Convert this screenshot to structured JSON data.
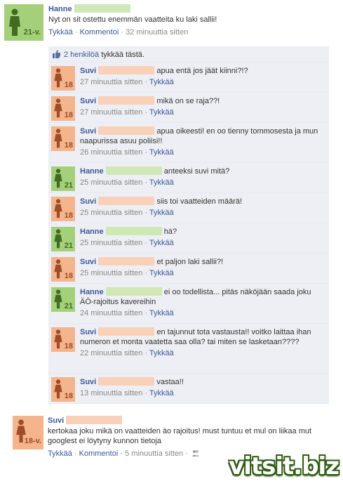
{
  "post": {
    "author": "Hanne",
    "avatar_age": "21-v.",
    "message": "Nyt on sit ostettu enemmän vaatteita ku laki sallii!",
    "like_link": "Tykkää",
    "comment_link": "Kommentoi",
    "time": "32 minuuttia sitten",
    "likes_count": "2 henkilöä",
    "likes_suffix": "tykkää tästä."
  },
  "comments": [
    {
      "author": "Suvi",
      "age": "18",
      "color": "peach",
      "text": "apua entä jos jäät kiinni?!?",
      "time": "27 minuuttia sitten",
      "like": "Tykkää"
    },
    {
      "author": "Suvi",
      "age": "18",
      "color": "peach",
      "text": "mikä on se raja??!",
      "time": "27 minuuttia sitten",
      "like": "Tykkää"
    },
    {
      "author": "Suvi",
      "age": "18",
      "color": "peach",
      "text": "apua oikeesti! en oo tienny tommosesta ja mun naapurissa asuu poliisi!!",
      "time": "26 minuuttia sitten",
      "like": "Tykkää"
    },
    {
      "author": "Hanne",
      "age": "21",
      "color": "green",
      "text": "anteeksi suvi mitä?",
      "time": "25 minuuttia sitten",
      "like": "Tykkää"
    },
    {
      "author": "Suvi",
      "age": "18",
      "color": "peach",
      "text": "siis toi vaatteiden määrä!",
      "time": "25 minuuttia sitten",
      "like": "Tykkää"
    },
    {
      "author": "Hanne",
      "age": "21",
      "color": "green",
      "text": "hä?",
      "time": "25 minuuttia sitten",
      "like": "Tykkää"
    },
    {
      "author": "Suvi",
      "age": "18",
      "color": "peach",
      "text": "et paljon laki sallii?!",
      "time": "25 minuuttia sitten",
      "like": "Tykkää"
    },
    {
      "author": "Hanne",
      "age": "21",
      "color": "green",
      "text": "ei oo todellista... pitäs näköjään saada joku ÄÖ-rajoitus kavereihin",
      "time": "24 minuuttia sitten",
      "like": "Tykkää"
    },
    {
      "author": "Suvi",
      "age": "18",
      "color": "peach",
      "text": "en tajunnut tota vastausta!! voitko laittaa ihan numeron et monta vaatetta saa olla? tai miten se lasketaan????",
      "time": "22 minuuttia sitten",
      "like": "Tykkää"
    },
    {
      "author": "Suvi",
      "age": "18",
      "color": "peach",
      "text": "vastaa!!",
      "time": "13 minuuttia sitten",
      "like": "Tykkää"
    }
  ],
  "post2": {
    "author": "Suvi",
    "avatar_age": "18-v.",
    "message": "kertokaa joku mikä on vaatteiden äo rajoitus! must tuntuu et mul on liikaa mut googlest ei löytyny kunnon tietoja",
    "like_link": "Tykkää",
    "comment_link": "Kommentoi",
    "time": "5 minuuttia sitten"
  },
  "watermark": "vitsit.biz"
}
